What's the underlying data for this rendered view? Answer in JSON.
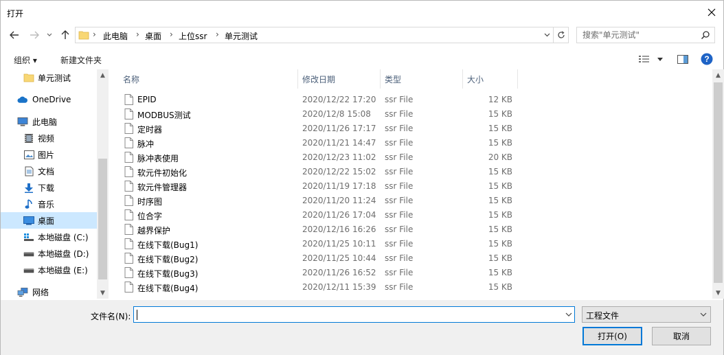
{
  "window": {
    "title": "打开"
  },
  "address": {
    "crumbs": [
      "此电脑",
      "桌面",
      "上位ssr",
      "单元测试"
    ]
  },
  "search": {
    "placeholder": "搜索\"单元测试\""
  },
  "toolbar": {
    "organize": "组织 ▾",
    "new_folder": "新建文件夹"
  },
  "nav": {
    "items": [
      {
        "label": "单元测试",
        "icon": "folder-icon"
      },
      {
        "label": "OneDrive",
        "icon": "cloud-icon"
      },
      {
        "label": "此电脑",
        "icon": "computer-icon"
      },
      {
        "label": "视频",
        "icon": "video-icon"
      },
      {
        "label": "图片",
        "icon": "picture-icon"
      },
      {
        "label": "文档",
        "icon": "document-icon"
      },
      {
        "label": "下载",
        "icon": "download-icon"
      },
      {
        "label": "音乐",
        "icon": "music-icon"
      },
      {
        "label": "桌面",
        "icon": "desktop-icon",
        "selected": true
      },
      {
        "label": "本地磁盘 (C:)",
        "icon": "drive-c-icon"
      },
      {
        "label": "本地磁盘 (D:)",
        "icon": "drive-icon"
      },
      {
        "label": "本地磁盘 (E:)",
        "icon": "drive-icon"
      },
      {
        "label": "网络",
        "icon": "network-icon"
      }
    ]
  },
  "columns": {
    "name": "名称",
    "date": "修改日期",
    "type": "类型",
    "size": "大小"
  },
  "files": [
    {
      "name": "EPID",
      "date": "2020/12/22 17:20",
      "type": "ssr File",
      "size": "12 KB"
    },
    {
      "name": "MODBUS测试",
      "date": "2020/12/8 15:08",
      "type": "ssr File",
      "size": "15 KB"
    },
    {
      "name": "定时器",
      "date": "2020/11/26 17:17",
      "type": "ssr File",
      "size": "15 KB"
    },
    {
      "name": "脉冲",
      "date": "2020/11/21 14:47",
      "type": "ssr File",
      "size": "15 KB"
    },
    {
      "name": "脉冲表使用",
      "date": "2020/12/23 11:02",
      "type": "ssr File",
      "size": "20 KB"
    },
    {
      "name": "软元件初始化",
      "date": "2020/12/22 15:02",
      "type": "ssr File",
      "size": "15 KB"
    },
    {
      "name": "软元件管理器",
      "date": "2020/11/19 17:18",
      "type": "ssr File",
      "size": "15 KB"
    },
    {
      "name": "时序图",
      "date": "2020/11/20 11:24",
      "type": "ssr File",
      "size": "15 KB"
    },
    {
      "name": "位合字",
      "date": "2020/11/26 17:04",
      "type": "ssr File",
      "size": "15 KB"
    },
    {
      "name": "越界保护",
      "date": "2020/12/16 16:26",
      "type": "ssr File",
      "size": "15 KB"
    },
    {
      "name": "在线下载(Bug1)",
      "date": "2020/11/25 10:11",
      "type": "ssr File",
      "size": "15 KB"
    },
    {
      "name": "在线下载(Bug2)",
      "date": "2020/11/25 10:44",
      "type": "ssr File",
      "size": "15 KB"
    },
    {
      "name": "在线下载(Bug3)",
      "date": "2020/11/26 16:52",
      "type": "ssr File",
      "size": "15 KB"
    },
    {
      "name": "在线下载(Bug4)",
      "date": "2020/12/11 15:39",
      "type": "ssr File",
      "size": "15 KB"
    }
  ],
  "filename": {
    "label": "文件名(N):",
    "value": ""
  },
  "filetype": {
    "selected": "工程文件"
  },
  "buttons": {
    "open": "打开(O)",
    "cancel": "取消"
  }
}
